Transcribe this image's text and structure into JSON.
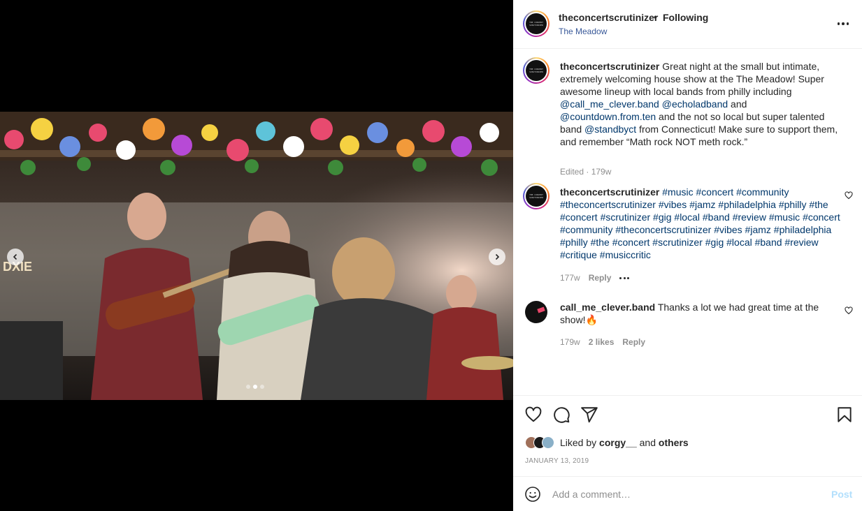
{
  "header": {
    "username": "theconcertscrutinizer",
    "separator": "•",
    "follow_status": "Following",
    "location": "The Meadow",
    "avatar_text": "THE CONCERT SCRUTINIZER"
  },
  "caption": {
    "username": "theconcertscrutinizer",
    "text_1": "Great night at the small but intimate, extremely welcoming house show at the The Meadow! Super awesome lineup with local bands from philly including ",
    "mention_1": "@call_me_clever.band",
    "mention_2": "@echoladband",
    "text_and": " and ",
    "mention_3": "@countdown.from.ten",
    "text_2": " and the not so local but super talented band ",
    "mention_4": "@standbyct",
    "text_3": " from Connecticut! Make sure to support them, and remember “Math rock NOT meth rock.”",
    "meta": "Edited · 179w"
  },
  "hashtag_comment": {
    "username": "theconcertscrutinizer",
    "hashtags": "#music #concert #community #theconcertscrutinizer #vibes #jamz #philadelphia #philly #the #concert #scrutinizer #gig #local #band #review #music #concert #community #theconcertscrutinizer #vibes #jamz #philadelphia #philly #the #concert #scrutinizer #gig #local #band #review #critique #musiccritic",
    "age": "177w",
    "reply": "Reply"
  },
  "reply_comment": {
    "username": "call_me_clever.band",
    "text": "Thanks a lot we had great time at the show!🔥",
    "age": "179w",
    "likes": "2 likes",
    "reply": "Reply"
  },
  "likes": {
    "prefix": "Liked by",
    "user": "corgy__",
    "and": "and",
    "others": "others"
  },
  "date": "JANUARY 13, 2019",
  "comment_box": {
    "placeholder": "Add a comment…",
    "post_label": "Post"
  },
  "carousel": {
    "count": 3,
    "active_index": 1
  },
  "colors": {
    "link": "#00376b",
    "location": "#385898",
    "post_button": "#b2dffc",
    "meta": "#8e8e8e"
  },
  "icons": [
    "chevron-left-icon",
    "chevron-right-icon",
    "more-icon",
    "heart-icon",
    "comment-icon",
    "share-icon",
    "bookmark-icon",
    "emoji-icon"
  ]
}
